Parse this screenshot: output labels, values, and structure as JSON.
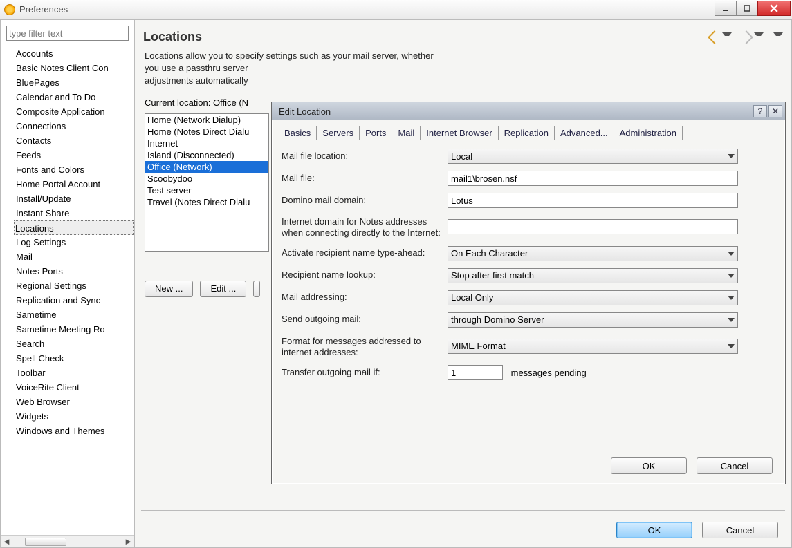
{
  "window": {
    "title": "Preferences"
  },
  "filter": {
    "placeholder": "type filter text"
  },
  "tree": {
    "items": [
      "Accounts",
      "Basic Notes Client Con",
      "BluePages",
      "Calendar and To Do",
      "Composite Application",
      "Connections",
      "Contacts",
      "Feeds",
      "Fonts and Colors",
      "Home Portal Account",
      "Install/Update",
      "Instant Share",
      "Locations",
      "Log Settings",
      "Mail",
      "Notes Ports",
      "Regional Settings",
      "Replication and Sync",
      "Sametime",
      "Sametime Meeting Ro",
      "Search",
      "Spell Check",
      "Toolbar",
      "VoiceRite Client",
      "Web Browser",
      "Widgets",
      "Windows and Themes"
    ],
    "selected_index": 12
  },
  "page": {
    "heading": "Locations",
    "description_l1": "Locations allow you to specify settings such as your mail server, whether",
    "description_l2": "you use a passthru server",
    "description_l3": "adjustments automatically",
    "current_label": "Current location: Office (N",
    "list": [
      "Home (Network Dialup)",
      "Home (Notes Direct Dialu",
      "Internet",
      "Island (Disconnected)",
      "Office (Network)",
      "Scoobydoo",
      "Test server",
      "Travel (Notes Direct Dialu"
    ],
    "list_selected_index": 4,
    "btn_new": "New ...",
    "btn_edit": "Edit ...",
    "btn_ok": "OK",
    "btn_cancel": "Cancel"
  },
  "dialog": {
    "title": "Edit Location",
    "tabs": [
      "Basics",
      "Servers",
      "Ports",
      "Mail",
      "Internet Browser",
      "Replication",
      "Advanced...",
      "Administration"
    ],
    "active_tab_index": 3,
    "fields": {
      "mail_file_location_label": "Mail file location:",
      "mail_file_location_value": "Local",
      "mail_file_label": "Mail file:",
      "mail_file_value": "mail1\\brosen.nsf",
      "domino_domain_label": "Domino mail domain:",
      "domino_domain_value": "Lotus",
      "internet_domain_label": "Internet domain for Notes addresses when connecting directly to the Internet:",
      "internet_domain_value": "",
      "typeahead_label": "Activate recipient name type-ahead:",
      "typeahead_value": "On Each Character",
      "lookup_label": "Recipient name lookup:",
      "lookup_value": "Stop after first match",
      "addressing_label": "Mail addressing:",
      "addressing_value": "Local Only",
      "outgoing_label": "Send outgoing mail:",
      "outgoing_value": "through Domino Server",
      "format_label": "Format for messages addressed to internet addresses:",
      "format_value": "MIME Format",
      "transfer_label": "Transfer outgoing mail if:",
      "transfer_value": "1",
      "transfer_suffix": "messages pending"
    },
    "btn_ok": "OK",
    "btn_cancel": "Cancel"
  }
}
